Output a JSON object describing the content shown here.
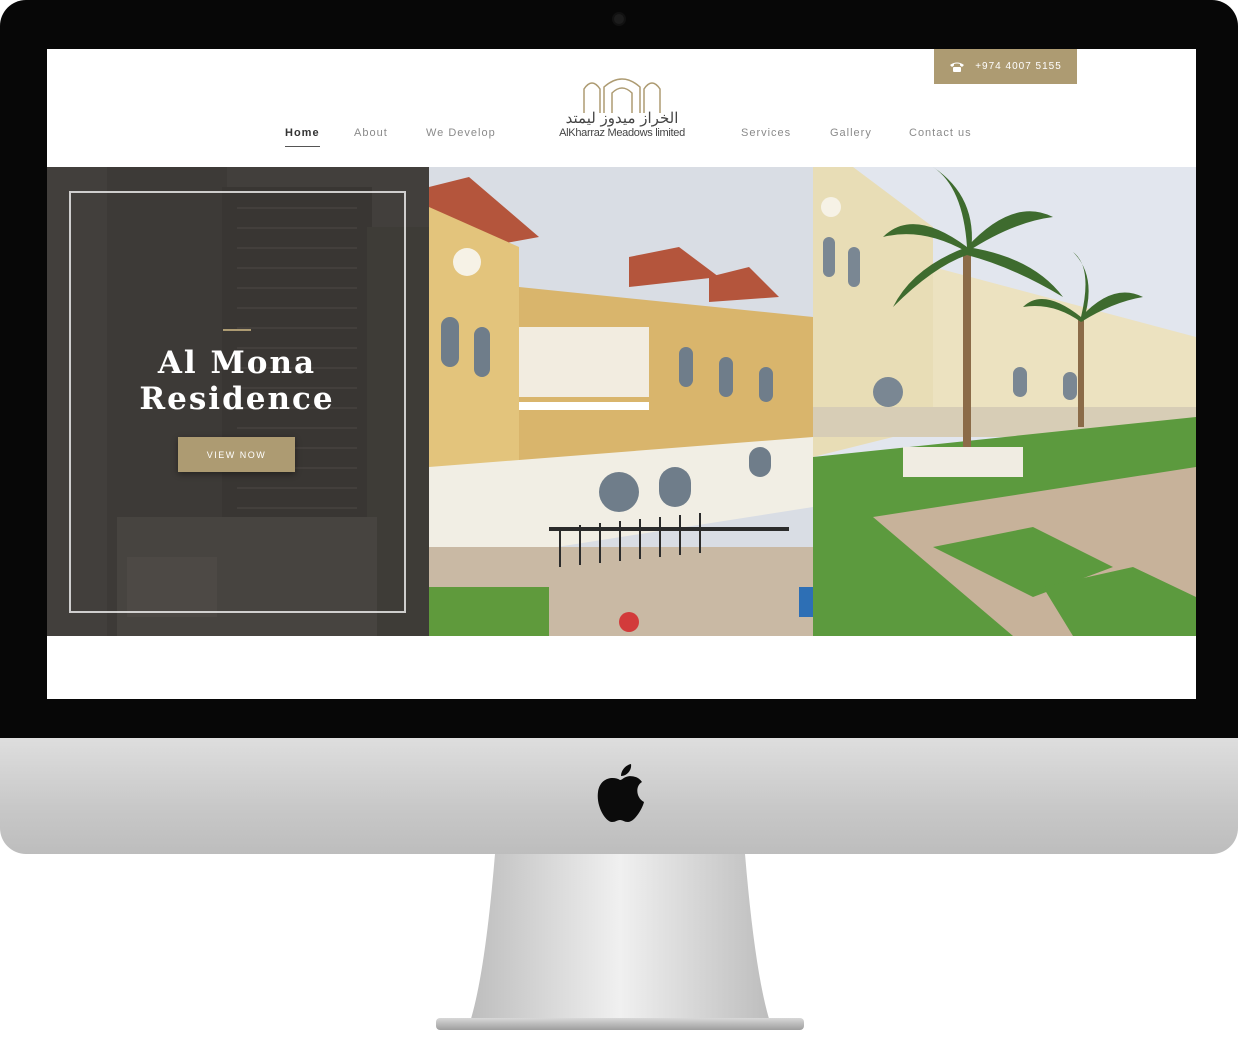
{
  "header": {
    "phone_number": "+974 4007 5155",
    "logo_arabic": "الخراز ميدوز ليمتد",
    "logo_english": "AlKharraz Meadows limited"
  },
  "nav": {
    "items": [
      {
        "label": "Home",
        "active": true
      },
      {
        "label": "About"
      },
      {
        "label": "We Develop"
      },
      {
        "label": "Services"
      },
      {
        "label": "Gallery"
      },
      {
        "label": "Contact us"
      }
    ]
  },
  "hero": {
    "title_line1": "Al Mona",
    "title_line2": "Residence",
    "button_label": "VIEW NOW"
  },
  "colors": {
    "accent_gold": "#ad9b72",
    "bezel": "#070707",
    "chin": "#cfcfcf"
  },
  "icons": [
    "phone-icon",
    "apple-logo-icon"
  ]
}
